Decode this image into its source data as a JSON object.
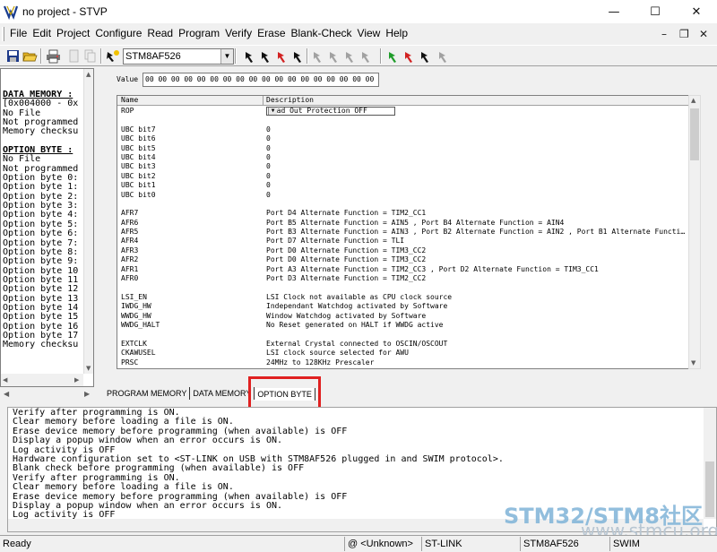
{
  "window": {
    "title": "no project - STVP"
  },
  "menu": [
    "File",
    "Edit",
    "Project",
    "Configure",
    "Read",
    "Program",
    "Verify",
    "Erase",
    "Blank-Check",
    "View",
    "Help"
  ],
  "toolbar": {
    "device": "STM8AF526"
  },
  "left_panel": {
    "lines": [
      {
        "t": "DATA MEMORY :",
        "h": true
      },
      {
        "t": "[0x004000 - 0x"
      },
      {
        "t": "No File"
      },
      {
        "t": "Not programmed"
      },
      {
        "t": "Memory checksu"
      },
      {
        "t": ""
      },
      {
        "t": "OPTION BYTE :",
        "h": true
      },
      {
        "t": "No File"
      },
      {
        "t": "Not programmed"
      },
      {
        "t": "Option byte 0:"
      },
      {
        "t": "Option byte 1:"
      },
      {
        "t": "Option byte 2:"
      },
      {
        "t": "Option byte 3:"
      },
      {
        "t": "Option byte 4:"
      },
      {
        "t": "Option byte 5:"
      },
      {
        "t": "Option byte 6:"
      },
      {
        "t": "Option byte 7:"
      },
      {
        "t": "Option byte 8:"
      },
      {
        "t": "Option byte 9:"
      },
      {
        "t": "Option byte 10"
      },
      {
        "t": "Option byte 11"
      },
      {
        "t": "Option byte 12"
      },
      {
        "t": "Option byte 13"
      },
      {
        "t": "Option byte 14"
      },
      {
        "t": "Option byte 15"
      },
      {
        "t": "Option byte 16"
      },
      {
        "t": "Option byte 17"
      },
      {
        "t": "Memory checksu"
      }
    ]
  },
  "value": {
    "label": "Value",
    "text": "00 00 00 00 00 00 00 00 00 00 00 00 00 00 00 00 00 00 C7 00"
  },
  "grid": {
    "headers": [
      "Name",
      "Description"
    ],
    "rop": {
      "name": "ROP",
      "value": "Read Out Protection OFF"
    },
    "rows": [
      [
        "",
        ""
      ],
      [
        "UBC bit7",
        "0"
      ],
      [
        "UBC bit6",
        "0"
      ],
      [
        "UBC bit5",
        "0"
      ],
      [
        "UBC bit4",
        "0"
      ],
      [
        "UBC bit3",
        "0"
      ],
      [
        "UBC bit2",
        "0"
      ],
      [
        "UBC bit1",
        "0"
      ],
      [
        "UBC bit0",
        "0"
      ],
      [
        "",
        ""
      ],
      [
        "AFR7",
        "Port D4 Alternate Function = TIM2_CC1"
      ],
      [
        "AFR6",
        "Port B5 Alternate Function = AIN5 , Port B4 Alternate Function = AIN4"
      ],
      [
        "AFR5",
        "Port B3 Alternate Function = AIN3 , Port B2 Alternate Function = AIN2 , Port B1 Alternate Functi…"
      ],
      [
        "AFR4",
        "Port D7 Alternate Function = TLI"
      ],
      [
        "AFR3",
        "Port D0 Alternate Function = TIM3_CC2"
      ],
      [
        "AFR2",
        "Port D0 Alternate Function = TIM3_CC2"
      ],
      [
        "AFR1",
        "Port A3 Alternate Function = TIM2_CC3 , Port D2 Alternate Function = TIM3_CC1"
      ],
      [
        "AFR0",
        "Port D3 Alternate Function = TIM2_CC2"
      ],
      [
        "",
        ""
      ],
      [
        "LSI_EN",
        "LSI Clock not available as CPU clock source"
      ],
      [
        "IWDG_HW",
        "Independant Watchdog activated by Software"
      ],
      [
        "WWDG_HW",
        "Window Watchdog activated by Software"
      ],
      [
        "WWDG_HALT",
        "No Reset generated on HALT if WWDG active"
      ],
      [
        "",
        ""
      ],
      [
        "EXTCLK",
        "External Crystal connected to OSCIN/OSCOUT"
      ],
      [
        "CKAWUSEL",
        "LSI clock source selected for AWU"
      ],
      [
        "PRSC",
        "24MHz to 128KHz Prescaler"
      ]
    ]
  },
  "tabs": [
    "PROGRAM MEMORY",
    "DATA MEMORY",
    "OPTION BYTE"
  ],
  "active_tab": "OPTION BYTE",
  "log": [
    "Verify after programming is ON.",
    "Clear memory before loading a file is ON.",
    "Erase device memory before programming (when available) is OFF",
    "Display a popup window when an error occurs is ON.",
    "Log activity is OFF",
    "Hardware configuration set to <ST-LINK on USB with STM8AF526 plugged in and SWIM protocol>.",
    "Blank check before programming (when available) is OFF",
    "Verify after programming is ON.",
    "Clear memory before loading a file is ON.",
    "Erase device memory before programming (when available) is OFF",
    "Display a popup window when an error occurs is ON.",
    "Log activity is OFF"
  ],
  "watermark": {
    "brand": "STM32/STM8社区",
    "url": "www.stmcu.org"
  },
  "status": {
    "ready": "Ready",
    "address": "@ <Unknown>",
    "probe": "ST-LINK",
    "device": "STM8AF526",
    "protocol": "SWIM"
  },
  "colors": {
    "highlight": "#e02020",
    "play_green": "#1f9d2a",
    "play_red": "#d22222",
    "play_black": "#111111"
  }
}
